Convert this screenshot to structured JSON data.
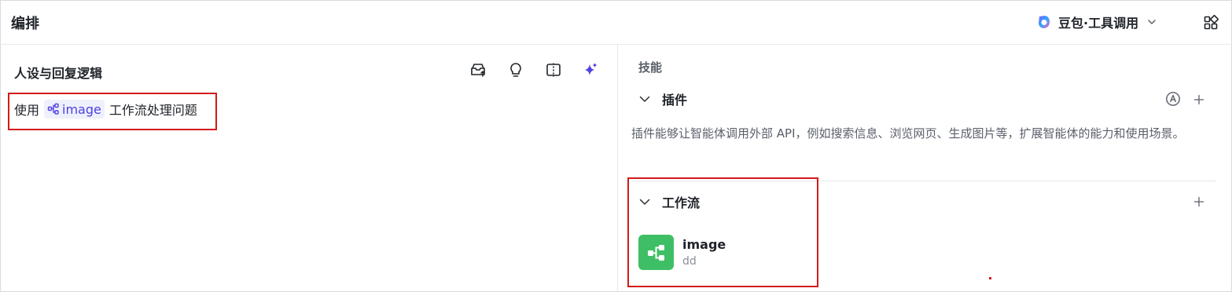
{
  "header": {
    "title": "编排",
    "model_label": "豆包·工具调用"
  },
  "persona": {
    "title": "人设与回复逻辑",
    "prompt_prefix": "使用",
    "prompt_workflow_ref": "image",
    "prompt_suffix": "工作流处理问题"
  },
  "skills": {
    "section_label": "技能",
    "plugins": {
      "label": "插件",
      "description": "插件能够让智能体调用外部 API，例如搜索信息、浏览网页、生成图片等，扩展智能体的能力和使用场景。"
    },
    "workflows": {
      "label": "工作流",
      "items": [
        {
          "name": "image",
          "description": "dd"
        }
      ]
    }
  },
  "colors": {
    "accent": "#4e40e5",
    "highlight_box": "#d41a1a",
    "workflow_tile": "#3fbf65"
  },
  "icons": {
    "toolbar": [
      "template-import-icon",
      "bulb-icon",
      "compare-icon",
      "sparkle-icon"
    ],
    "header": [
      "doubao-logo-icon",
      "chevron-down-icon",
      "grid-apps-icon"
    ]
  }
}
